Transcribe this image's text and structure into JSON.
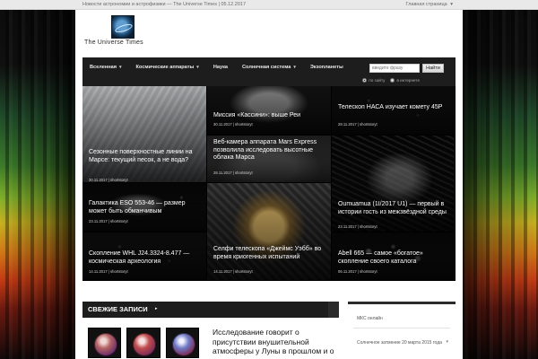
{
  "topbar": {
    "tagline": "Новости астрономии и астрофизики — The Universe Times | 05.12.2017",
    "home": "Главная страница"
  },
  "logo": {
    "name": "The Universe Times"
  },
  "nav": {
    "items": [
      {
        "label": "Вселенная",
        "has_caret": true
      },
      {
        "label": "Космические аппараты",
        "has_caret": true
      },
      {
        "label": "Наука",
        "has_caret": false
      },
      {
        "label": "Солнечная система",
        "has_caret": true
      },
      {
        "label": "Экзопланеты",
        "has_caret": false
      }
    ],
    "search": {
      "placeholder": "введите фразу",
      "button": "Найти",
      "options": [
        {
          "label": "по сайту",
          "selected": true
        },
        {
          "label": "в интернете",
          "selected": false
        }
      ]
    }
  },
  "grid": {
    "tiles": [
      {
        "title": "Сезонные поверхностные линии на Марсе: текущий песок, а не вода?",
        "meta": "30.11.2017 | shortstoryt"
      },
      {
        "title": "Миссия «Кассини»: выше Реи",
        "meta": "30.11.2017 | shortstoryt"
      },
      {
        "title": "Телескоп НАСА изучает комету 45P",
        "meta": "28.11.2017 | shortstoryt"
      },
      {
        "title": "Веб-камера аппарата Mars Express позволила исследовать высотные облака Марса",
        "meta": "28.11.2017 | shortstoryt"
      },
      {
        "title": "Галактика ESO 553-46 — размер может быть обманчивым",
        "meta": "23.11.2017 | shortstoryt"
      },
      {
        "title": "Oumuamua (1I/2017 U1) — первый в истории гость из межзвёздной среды",
        "meta": "23.11.2017 | shortstoryt"
      },
      {
        "title": "Скопление WHL J24.3324-8.477 — космическая археология",
        "meta": "14.11.2017 | shortstoryt"
      },
      {
        "title": "Селфи телескопа «Джеймс Уэбб» во время криогенных испытаний",
        "meta": "14.11.2017 | shortstoryt"
      },
      {
        "title": "Abell 665 — самое «богатое» скопление своего каталога",
        "meta": "06.11.2017 | shortstoryt"
      }
    ]
  },
  "fresh": {
    "label": "СВЕЖИЕ ЗАПИСИ",
    "article_title": "Исследование говорит о присутствии внушительной атмосферы у Луны в прошлом и о"
  },
  "sidebar": {
    "items": [
      {
        "label": "МКС онлайн"
      },
      {
        "label": "Солнечное затмение 20 марта 2015 года"
      }
    ]
  }
}
